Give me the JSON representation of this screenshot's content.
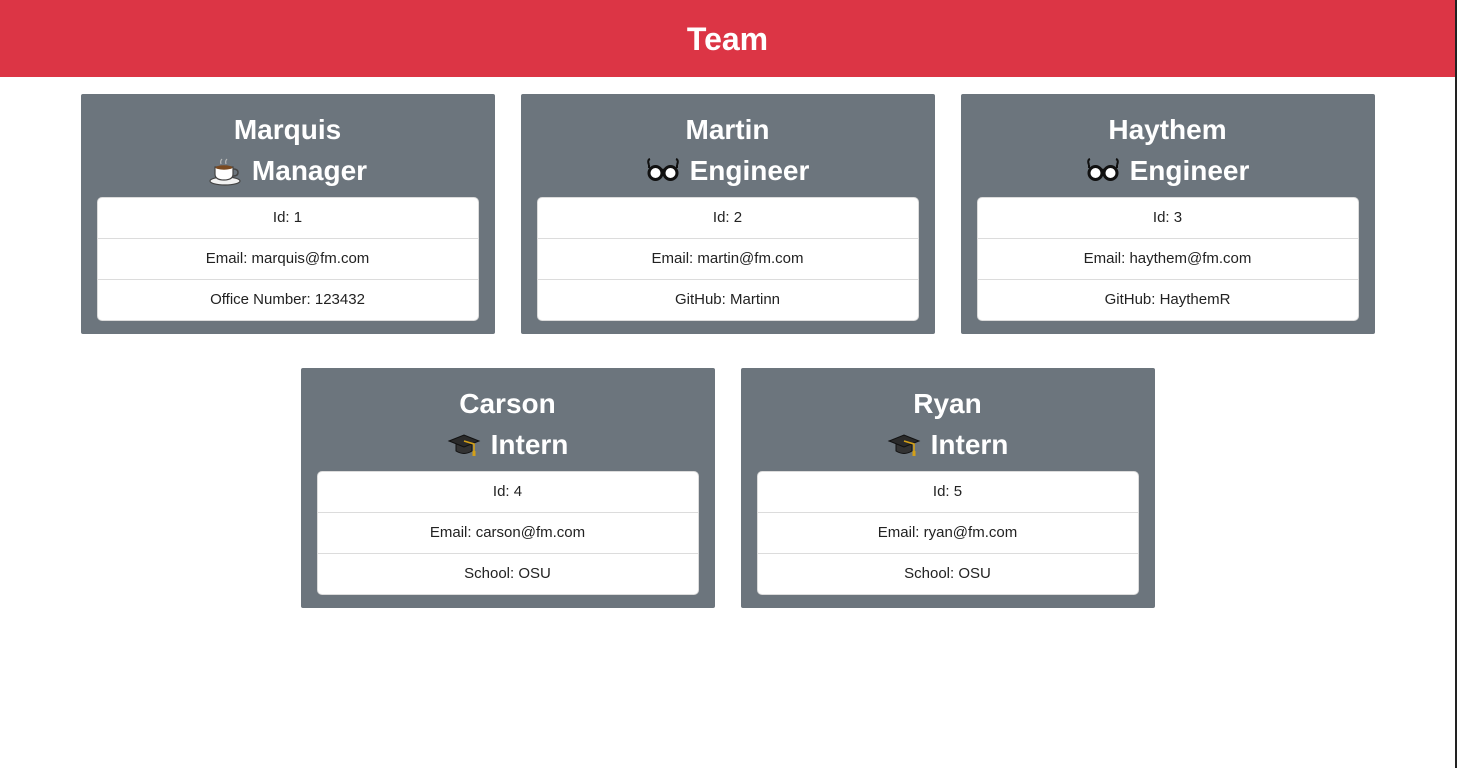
{
  "header": {
    "title": "Team"
  },
  "employees": [
    {
      "name": "Marquis",
      "role": "Manager",
      "icon": "coffee-cup-icon",
      "id_text": "Id: 1",
      "email_text": "Email: marquis@fm.com",
      "extra_text": "Office Number: 123432"
    },
    {
      "name": "Martin",
      "role": "Engineer",
      "icon": "glasses-icon",
      "id_text": "Id: 2",
      "email_text": "Email: martin@fm.com",
      "extra_text": "GitHub: Martinn"
    },
    {
      "name": "Haythem",
      "role": "Engineer",
      "icon": "glasses-icon",
      "id_text": "Id: 3",
      "email_text": "Email: haythem@fm.com",
      "extra_text": "GitHub: HaythemR"
    },
    {
      "name": "Carson",
      "role": "Intern",
      "icon": "graduation-cap-icon",
      "id_text": "Id: 4",
      "email_text": "Email: carson@fm.com",
      "extra_text": "School: OSU"
    },
    {
      "name": "Ryan",
      "role": "Intern",
      "icon": "graduation-cap-icon",
      "id_text": "Id: 5",
      "email_text": "Email: ryan@fm.com",
      "extra_text": "School: OSU"
    }
  ],
  "colors": {
    "header_bg": "#dc3545",
    "card_bg": "#6c757d"
  }
}
